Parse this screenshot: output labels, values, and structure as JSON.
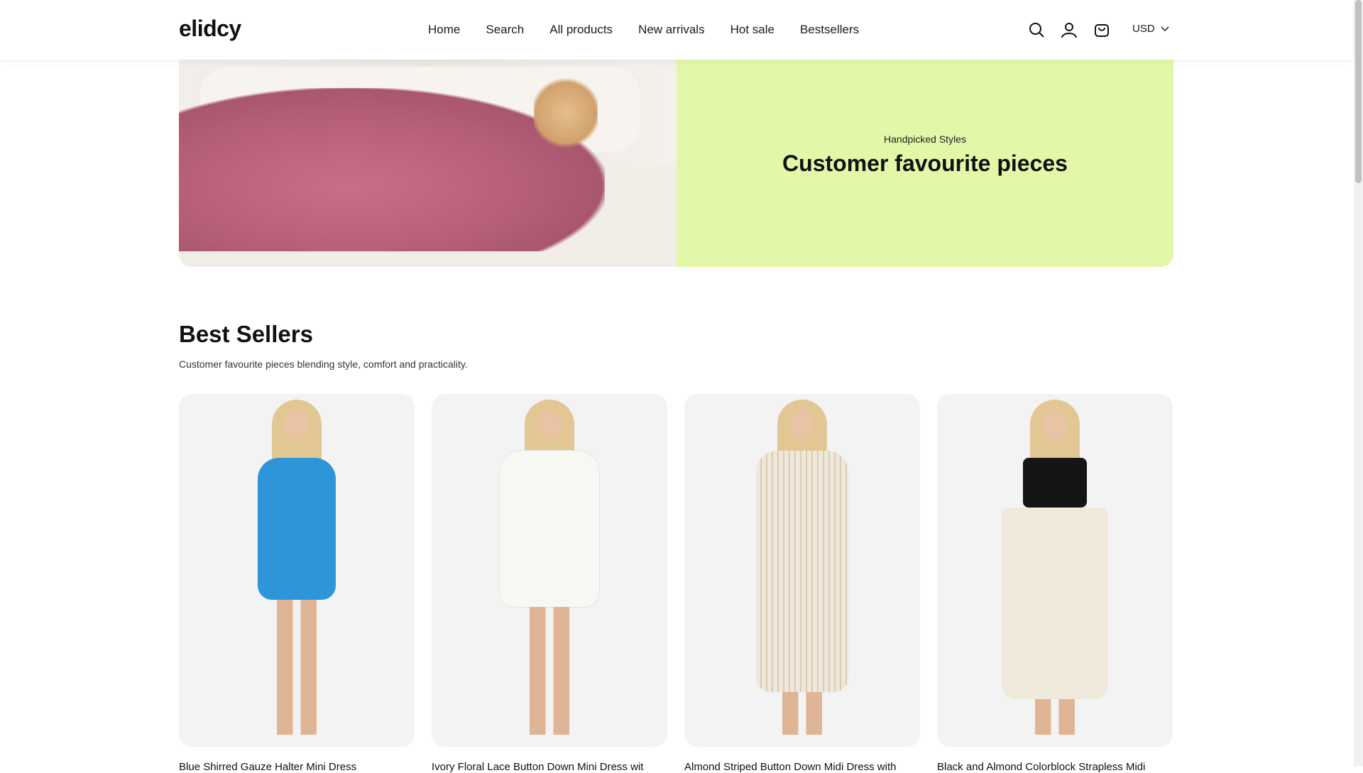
{
  "header": {
    "logo": "elidcy",
    "nav": [
      "Home",
      "Search",
      "All products",
      "New arrivals",
      "Hot sale",
      "Bestsellers"
    ],
    "currency": "USD"
  },
  "hero": {
    "subtitle": "Handpicked Styles",
    "title": "Customer favourite pieces",
    "bg_color": "#e2f8a8"
  },
  "best_sellers": {
    "title": "Best Sellers",
    "subtitle": "Customer favourite pieces blending style, comfort and practicality.",
    "products": [
      {
        "name": "Blue Shirred Gauze Halter Mini Dress",
        "dress_color": "#2f95d9"
      },
      {
        "name": "Ivory Floral Lace Button Down Mini Dress wit",
        "dress_color": "#f5f5f2"
      },
      {
        "name": "Almond Striped Button Down Midi Dress with",
        "dress_color": "#ece4d6"
      },
      {
        "name": "Black and Almond Colorblock Strapless Midi",
        "dress_color": "#efe9dc"
      }
    ]
  },
  "icons": [
    "search-icon",
    "user-icon",
    "cart-icon",
    "chevron-down-icon"
  ]
}
